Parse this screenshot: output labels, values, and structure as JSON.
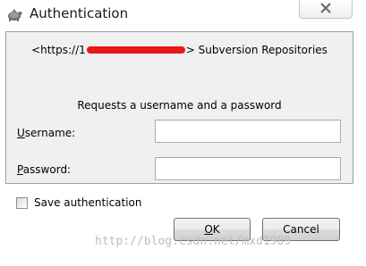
{
  "window": {
    "title": "Authentication"
  },
  "prompt": {
    "url_prefix": "<https://1",
    "url_suffix": "> Subversion Repositories",
    "request_text": "Requests a username and a password"
  },
  "username": {
    "mnemonic": "U",
    "label_rest": "sername:",
    "value": ""
  },
  "password": {
    "mnemonic": "P",
    "label_rest": "assword:",
    "value": ""
  },
  "save_auth": {
    "label": "Save authentication",
    "checked": false
  },
  "buttons": {
    "ok_mnemonic": "O",
    "ok_rest": "K",
    "cancel_label": "Cancel"
  },
  "watermark": "http://blog.csdn.net/mxd1989",
  "icons": {
    "app": "tortoise-icon",
    "close": "close-icon"
  },
  "colors": {
    "redaction": "#e8161d",
    "panel": "#f0f0f0"
  }
}
